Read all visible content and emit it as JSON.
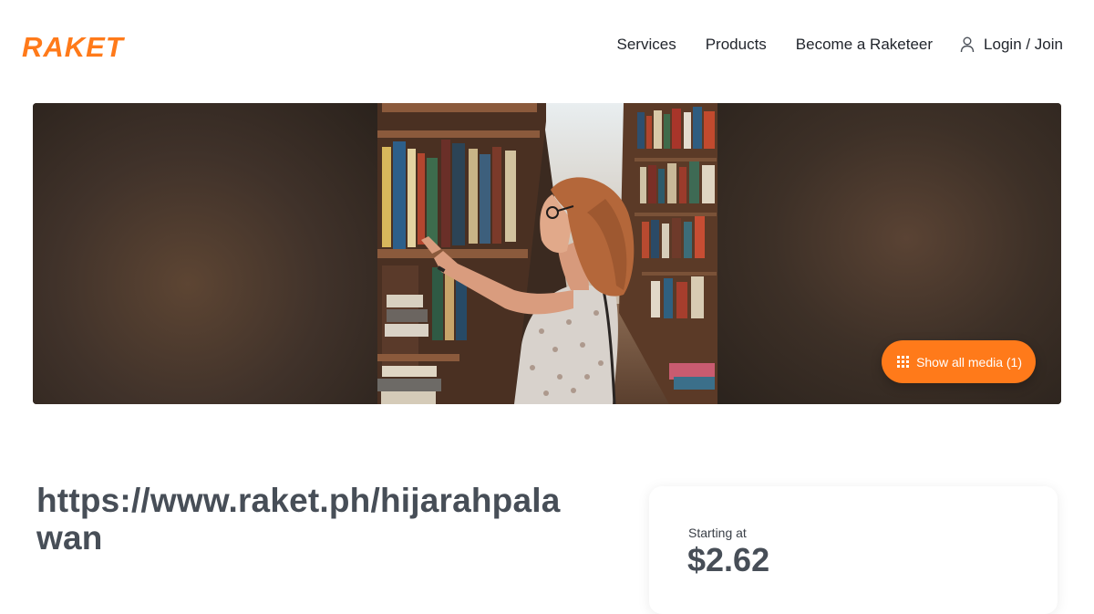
{
  "header": {
    "logo_text": "RAKET",
    "nav": [
      "Services",
      "Products",
      "Become a Raketeer"
    ],
    "login_label": "Login / Join"
  },
  "hero": {
    "show_media_label": "Show all media (1)"
  },
  "listing": {
    "title": "https://www.raket.ph/hijarahpalawan"
  },
  "price_card": {
    "label": "Starting at",
    "value": "$2.62"
  },
  "colors": {
    "brand": "#ff7a1a",
    "text_dark": "#474e57"
  },
  "icons": {
    "user": "user-icon",
    "grid": "grid-icon"
  }
}
